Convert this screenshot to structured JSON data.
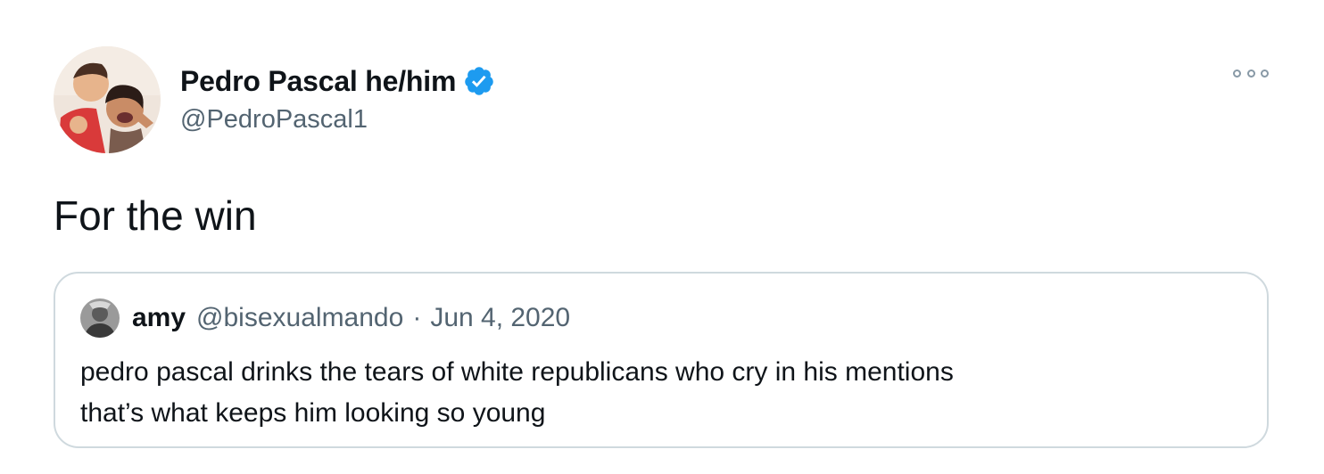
{
  "tweet": {
    "author": {
      "display_name": "Pedro Pascal he/him",
      "handle": "@PedroPascal1",
      "verified": true,
      "verified_color": "#1d9bf0"
    },
    "text": "For the win",
    "more_icon": "ellipsis-icon"
  },
  "quoted_tweet": {
    "author": {
      "display_name": "amy",
      "handle": "@bisexualmando"
    },
    "separator": "·",
    "date": "Jun 4, 2020",
    "text_lines": [
      "pedro pascal drinks the tears of white republicans who cry in his mentions",
      "that’s what keeps him looking so young"
    ]
  }
}
